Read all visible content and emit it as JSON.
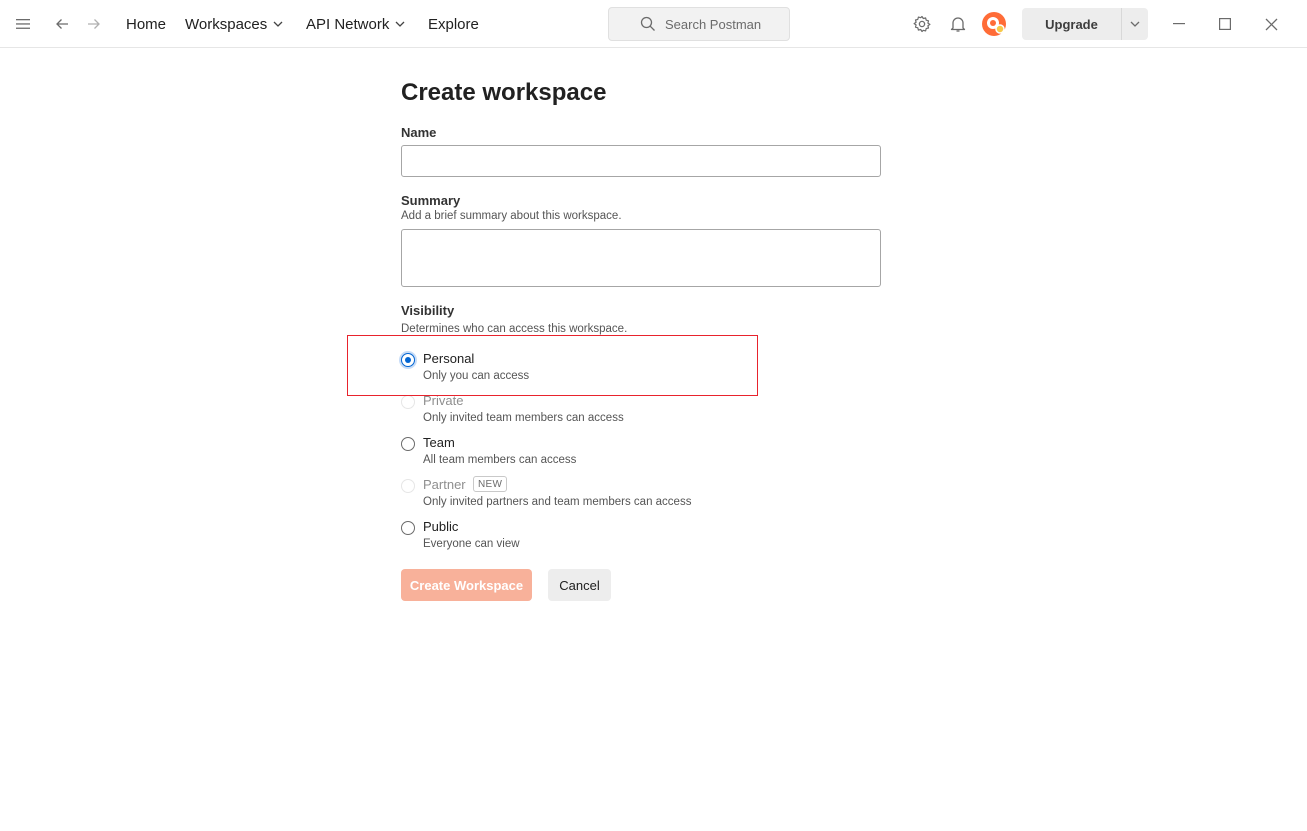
{
  "topbar": {
    "icons": {
      "menu": "hamburger-menu-icon",
      "back": "arrow-left-icon",
      "forward": "arrow-right-icon",
      "settings": "gear-icon",
      "notifications": "bell-icon",
      "minimize": "window-minimize-icon",
      "maximize": "window-maximize-icon",
      "close": "window-close-icon"
    },
    "nav": {
      "home": "Home",
      "workspaces": "Workspaces",
      "api_network": "API Network",
      "explore": "Explore"
    },
    "search_placeholder": "Search Postman",
    "upgrade_label": "Upgrade"
  },
  "form": {
    "title": "Create workspace",
    "name": {
      "label": "Name",
      "value": ""
    },
    "summary": {
      "label": "Summary",
      "help": "Add a brief summary about this workspace.",
      "value": ""
    },
    "visibility": {
      "label": "Visibility",
      "help": "Determines who can access this workspace.",
      "selected": "Personal",
      "options": [
        {
          "label": "Personal",
          "description": "Only you can access",
          "checked": true,
          "disabled": false
        },
        {
          "label": "Private",
          "description": "Only invited team members can access",
          "checked": false,
          "disabled": true
        },
        {
          "label": "Team",
          "description": "All team members can access",
          "checked": false,
          "disabled": false
        },
        {
          "label": "Partner",
          "badge": "NEW",
          "description": "Only invited partners and team members can access",
          "checked": false,
          "disabled": true
        },
        {
          "label": "Public",
          "description": "Everyone can view",
          "checked": false,
          "disabled": false
        }
      ]
    },
    "create_button": "Create Workspace",
    "cancel_button": "Cancel"
  },
  "colors": {
    "accent": "#0265d2",
    "create_button_bg": "#f8b19a",
    "highlight_border": "#e8232d",
    "brand_logo": "#ff6c37"
  }
}
